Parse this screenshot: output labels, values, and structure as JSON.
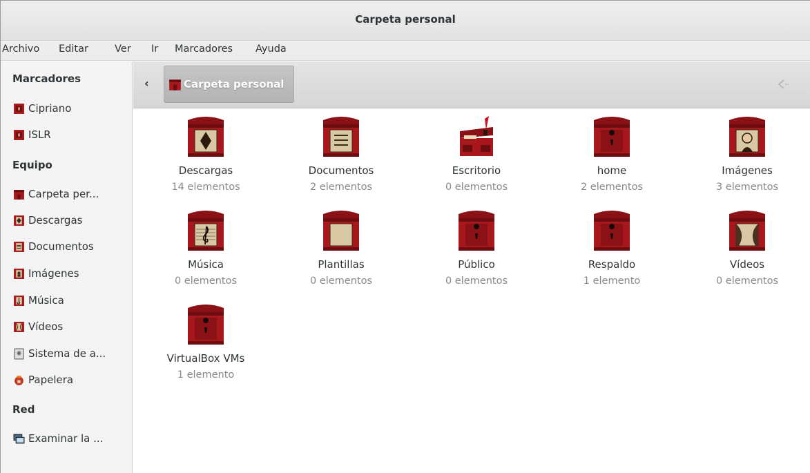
{
  "window": {
    "title": "Carpeta personal"
  },
  "menubar": [
    "Archivo",
    "Editar",
    "Ver",
    "Ir",
    "Marcadores",
    "Ayuda"
  ],
  "sidebar": {
    "sections": [
      "Marcadores",
      "Equipo",
      "Red"
    ],
    "items": [
      {
        "label": "Cipriano",
        "icon": "bookmark-folder-icon"
      },
      {
        "label": "ISLR",
        "icon": "bookmark-folder-icon"
      },
      {
        "label": "Carpeta per...",
        "icon": "home-folder-icon"
      },
      {
        "label": "Descargas",
        "icon": "downloads-folder-icon"
      },
      {
        "label": "Documentos",
        "icon": "documents-folder-icon"
      },
      {
        "label": "Imágenes",
        "icon": "pictures-folder-icon"
      },
      {
        "label": "Música",
        "icon": "music-folder-icon"
      },
      {
        "label": "Vídeos",
        "icon": "videos-folder-icon"
      },
      {
        "label": "Sistema de a...",
        "icon": "filesystem-icon"
      },
      {
        "label": "Papelera",
        "icon": "trash-icon"
      },
      {
        "label": "Examinar la ...",
        "icon": "network-icon"
      }
    ]
  },
  "pathbar": {
    "back_label": "‹",
    "current": "Carpeta personal"
  },
  "files": [
    {
      "name": "Descargas",
      "count": "14 elementos",
      "kind": "downloads"
    },
    {
      "name": "Documentos",
      "count": "2 elementos",
      "kind": "documents"
    },
    {
      "name": "Escritorio",
      "count": "0 elementos",
      "kind": "desktop"
    },
    {
      "name": "home",
      "count": "2 elementos",
      "kind": "plain"
    },
    {
      "name": "Imágenes",
      "count": "3 elementos",
      "kind": "pictures"
    },
    {
      "name": "Música",
      "count": "0 elementos",
      "kind": "music"
    },
    {
      "name": "Plantillas",
      "count": "0 elementos",
      "kind": "templates"
    },
    {
      "name": "Público",
      "count": "0 elementos",
      "kind": "plain"
    },
    {
      "name": "Respaldo",
      "count": "1 elemento",
      "kind": "plain"
    },
    {
      "name": "Vídeos",
      "count": "0 elementos",
      "kind": "videos"
    },
    {
      "name": "VirtualBox VMs",
      "count": "1 elemento",
      "kind": "plain"
    }
  ],
  "colors": {
    "chest_red": "#a8171c",
    "chest_dark": "#6e0d10",
    "panel_paper": "#d8c8a4"
  }
}
